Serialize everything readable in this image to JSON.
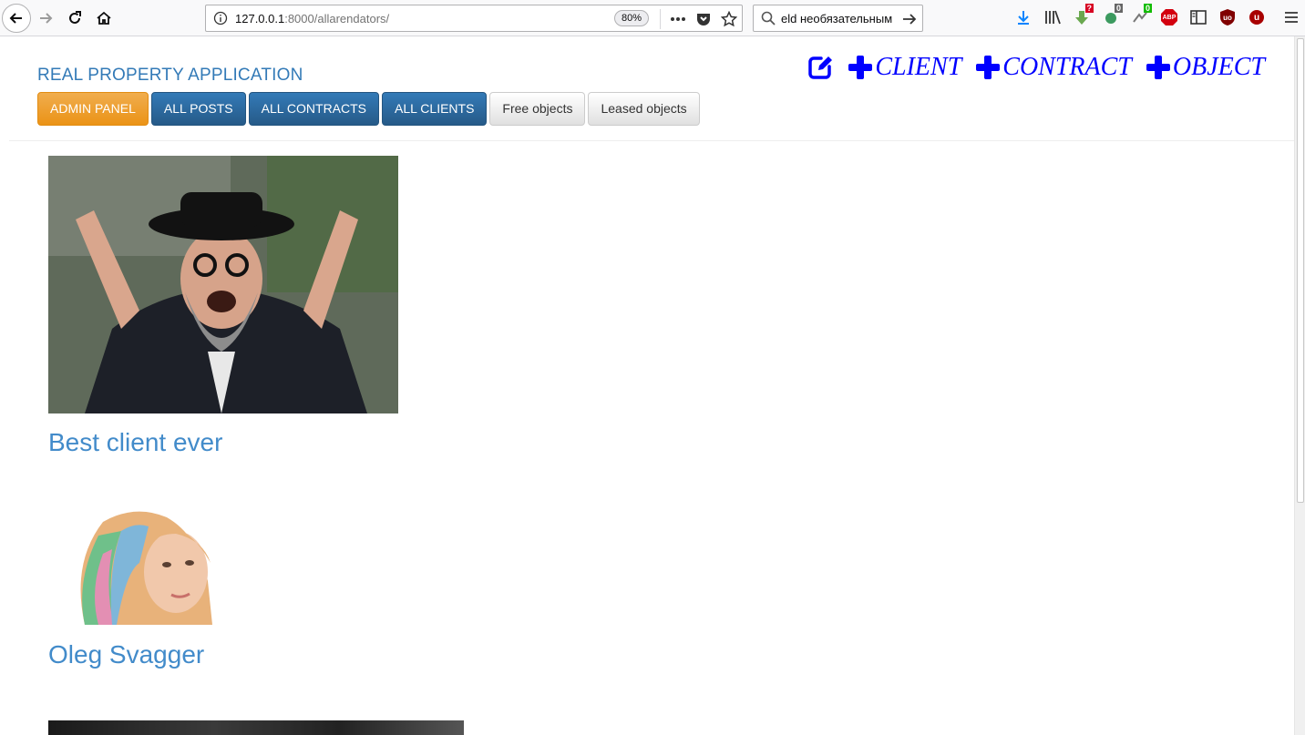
{
  "browser": {
    "url_host": "127.0.0.1",
    "url_path": ":8000/allarendators/",
    "zoom": "80%",
    "search_text": "eld необязательным",
    "extension_badges": {
      "download_helper": "?",
      "ext_two": "0",
      "ext_three": "0"
    },
    "extension_labels": {
      "adblock": "ABP",
      "ublock": "uo",
      "ublock_red": "u"
    }
  },
  "page": {
    "app_title": "REAL PROPERTY APPLICATION",
    "nav_buttons": [
      "ADMIN PANEL",
      "ALL POSTS",
      "ALL CONTRACTS",
      "ALL CLIENTS",
      "Free objects",
      "Leased objects"
    ],
    "actions": {
      "client": "CLIENT",
      "contract": "CONTRACT",
      "object": "OBJECT"
    },
    "clients": [
      {
        "name": "Best client ever",
        "image": "client-photo-man"
      },
      {
        "name": "Oleg Svagger",
        "image": "client-photo-woman"
      },
      {
        "name": "",
        "image": "client-photo-dark"
      }
    ]
  },
  "colors": {
    "link": "#428bca",
    "action": "#0000ff",
    "admin": "#f0ad4e",
    "primary": "#337ab7"
  }
}
